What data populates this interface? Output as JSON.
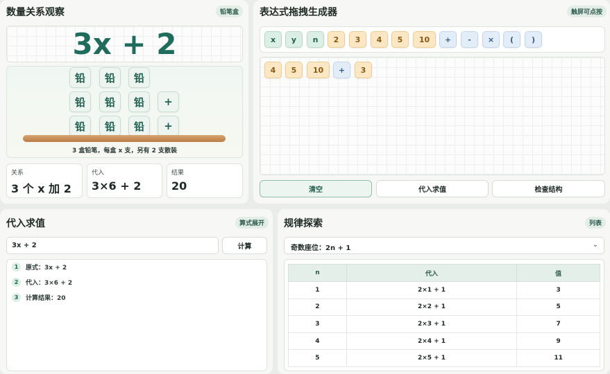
{
  "observe": {
    "title": "数量关系观察",
    "badge": "铅笔盒",
    "expression": "3x + 2",
    "tile_label": "铅",
    "extra_label": "+",
    "caption": "3 盒铅笔，每盒 x 支，另有 2 支散装",
    "stats": [
      {
        "label": "关系",
        "value": "3 个 x 加 2"
      },
      {
        "label": "代入",
        "value": "3×6 + 2"
      },
      {
        "label": "结果",
        "value": "20"
      }
    ]
  },
  "builder": {
    "title": "表达式拖拽生成器",
    "badge": "触屏可点按",
    "palette": [
      {
        "text": "x",
        "kind": "var"
      },
      {
        "text": "y",
        "kind": "var"
      },
      {
        "text": "n",
        "kind": "var"
      },
      {
        "text": "2",
        "kind": "num"
      },
      {
        "text": "3",
        "kind": "num"
      },
      {
        "text": "4",
        "kind": "num"
      },
      {
        "text": "5",
        "kind": "num"
      },
      {
        "text": "10",
        "kind": "num"
      },
      {
        "text": "+",
        "kind": "op"
      },
      {
        "text": "-",
        "kind": "op"
      },
      {
        "text": "×",
        "kind": "op"
      },
      {
        "text": "(",
        "kind": "op"
      },
      {
        "text": ")",
        "kind": "op"
      }
    ],
    "workspace": [
      {
        "text": "4",
        "kind": "num"
      },
      {
        "text": "5",
        "kind": "num"
      },
      {
        "text": "10",
        "kind": "num"
      },
      {
        "text": "+",
        "kind": "op"
      },
      {
        "text": "3",
        "kind": "num"
      }
    ],
    "buttons": {
      "clear": "清空",
      "evaluate": "代入求值",
      "check": "检查结构"
    }
  },
  "substitute": {
    "title": "代入求值",
    "badge": "算式展开",
    "input_value": "3x + 2",
    "compute_label": "计算",
    "steps": [
      {
        "num": "1",
        "text": "原式：3x + 2"
      },
      {
        "num": "2",
        "text": "代入：3×6 + 2"
      },
      {
        "num": "3",
        "text": "计算结果：20"
      }
    ]
  },
  "pattern": {
    "title": "规律探索",
    "badge": "列表",
    "select_value": "奇数座位：2n + 1",
    "columns": [
      "n",
      "代入",
      "值"
    ],
    "rows": [
      [
        "1",
        "2×1 + 1",
        "3"
      ],
      [
        "2",
        "2×2 + 1",
        "5"
      ],
      [
        "3",
        "2×3 + 1",
        "7"
      ],
      [
        "4",
        "2×4 + 1",
        "9"
      ],
      [
        "5",
        "2×5 + 1",
        "11"
      ]
    ]
  }
}
